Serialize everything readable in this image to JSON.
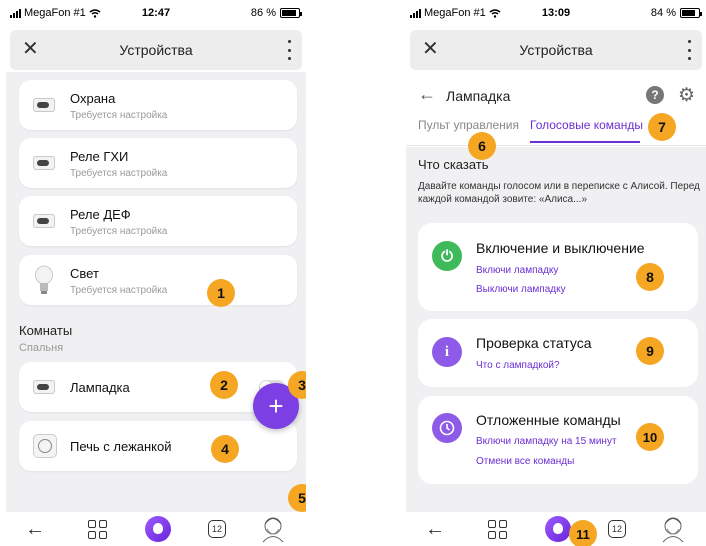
{
  "left": {
    "status": {
      "carrier": "MegaFon #1",
      "time": "12:47",
      "battery": "86 %"
    },
    "topbar": {
      "title": "Устройства"
    },
    "devices": [
      {
        "name": "Охрана",
        "status": "Требуется настройка"
      },
      {
        "name": "Реле ГХИ",
        "status": "Требуется настройка"
      },
      {
        "name": "Реле ДЕФ",
        "status": "Требуется настройка"
      },
      {
        "name": "Свет",
        "status": "Требуется настройка"
      }
    ],
    "rooms": {
      "title": "Комнаты",
      "room_name": "Спальня"
    },
    "room_devices": [
      {
        "name": "Лампадка",
        "toggle_on": false
      },
      {
        "name": "Печь с лежанкой"
      }
    ],
    "fab_label": "+",
    "nav": {
      "tabs_count": "12"
    },
    "badges": [
      "1",
      "2",
      "3",
      "4",
      "5"
    ]
  },
  "right": {
    "status": {
      "carrier": "MegaFon #1",
      "time": "13:09",
      "battery": "84 %"
    },
    "topbar": {
      "title": "Устройства"
    },
    "device": {
      "name": "Лампадка",
      "help_label": "?"
    },
    "tabs": [
      {
        "label": "Пульт управления",
        "active": false
      },
      {
        "label": "Голосовые команды",
        "active": true
      }
    ],
    "section": {
      "title": "Что сказать",
      "description": "Давайте команды голосом или в переписке с Алисой. Перед каждой командой зовите: «Алиса...»"
    },
    "commands": [
      {
        "title": "Включение и выключение",
        "icon": "power-icon",
        "color": "#3fba5a",
        "examples": [
          "Включи лампадку",
          "Выключи лампадку"
        ]
      },
      {
        "title": "Проверка статуса",
        "icon": "info-icon",
        "color": "#8e5be8",
        "examples": [
          "Что с лампадкой?"
        ]
      },
      {
        "title": "Отложенные команды",
        "icon": "clock-icon",
        "color": "#8e5be8",
        "examples": [
          "Включи лампадку на 15 минут",
          "Отмени все команды"
        ]
      }
    ],
    "nav": {
      "tabs_count": "12"
    },
    "badges": [
      "6",
      "7",
      "8",
      "9",
      "10",
      "11"
    ]
  },
  "colors": {
    "accent": "#7b3fe4",
    "badge": "#f5a623",
    "power": "#3fba5a",
    "info": "#8e5be8"
  }
}
